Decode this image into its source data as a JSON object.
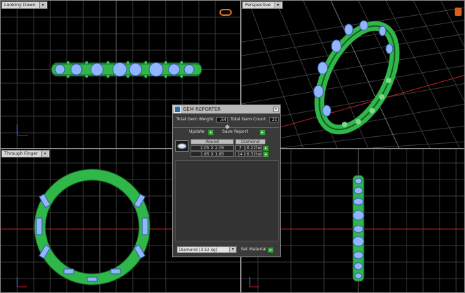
{
  "viewports": {
    "top_left": {
      "label": "Looking Down"
    },
    "top_right": {
      "label": "Perspective"
    },
    "bottom_left": {
      "label": "Through Finger"
    },
    "bottom_right": {
      "label": ""
    }
  },
  "gem_reporter": {
    "title": "GEM REPORTER",
    "total_gem_weight_label": "Total Gem Weight",
    "total_gem_weight_value": ".54",
    "total_gem_count_label": "Total Gem Count",
    "total_gem_count_value": "21",
    "update_label": "Update",
    "save_report_label": "Save Report",
    "columns": {
      "shape": "Round",
      "material": "Diamond"
    },
    "rows": [
      {
        "size": "2.05 X 2.05",
        "count": "7",
        "weight": "0.22tw"
      },
      {
        "size": "1.85 X 1.85",
        "count": "14",
        "weight": "0.32tw"
      }
    ],
    "material_select": "Diamond   (3.52 sg)",
    "set_material_label": "Set Material"
  },
  "colors": {
    "grid": "#3c3c3c",
    "grid_major": "#6a6a6a",
    "metal": "#2fb74a",
    "gem": "#8fb6ff",
    "axis_red": "#c0202a",
    "accent_button": "#3aa43a"
  }
}
